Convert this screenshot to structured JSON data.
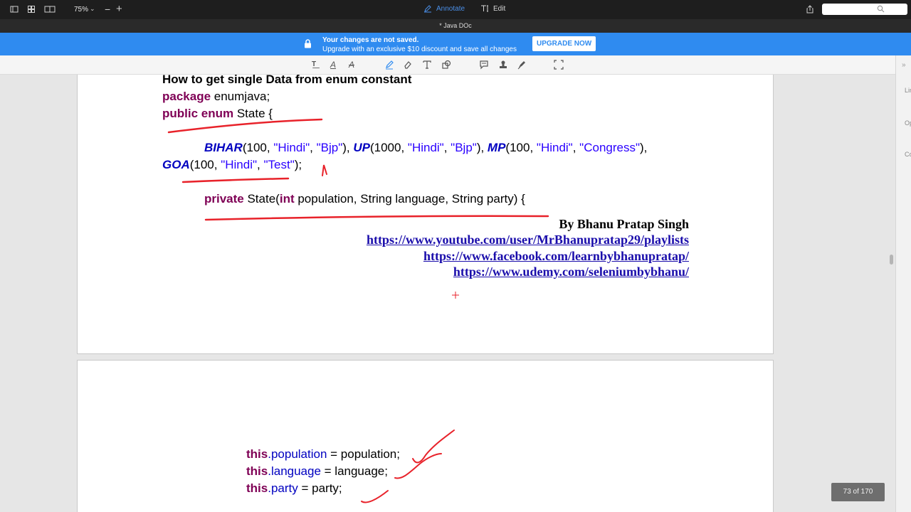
{
  "toolbar": {
    "zoom": "75%",
    "annotate_label": "Annotate",
    "edit_label": "Edit"
  },
  "document": {
    "title": "* Java DOc"
  },
  "banner": {
    "title": "Your changes are not saved.",
    "subtitle": "Upgrade with an exclusive $10 discount and save all changes",
    "button": "UPGRADE NOW",
    "color": "#2f8bf0"
  },
  "right_panel": {
    "labels": [
      "Lin",
      "Op",
      "Co"
    ]
  },
  "page1": {
    "heading": "How to get single Data from enum constant",
    "line_package_kw": "package",
    "line_package_rest": " enumjava;",
    "line_enum_kw": "public enum",
    "line_enum_rest": " State {",
    "bihar": "BIHAR",
    "bihar_args_a": "(100, ",
    "hindi1": "\"Hindi\"",
    "sep1": ", ",
    "bjp1": "\"Bjp\"",
    "close1": "), ",
    "up": "UP",
    "up_args_a": "(1000, ",
    "hindi2": "\"Hindi\"",
    "sep2": ", ",
    "bjp2": "\"Bjp\"",
    "close2": "), ",
    "mp": "MP",
    "mp_args_a": "(100, ",
    "hindi3": "\"Hindi\"",
    "sep3": ", ",
    "congress": "\"Congress\"",
    "close3": "),",
    "goa": "GOA",
    "goa_args_a": "(100, ",
    "hindi4": "\"Hindi\"",
    "sep4": ", ",
    "test": "\"Test\"",
    "close4": ");",
    "ctor_kw": "private",
    "ctor_a": " State(",
    "ctor_int": "int",
    "ctor_b": " population, String language, String party) {",
    "author": "By Bhanu Pratap Singh",
    "links": [
      "https://www.youtube.com/user/MrBhanupratap29/playlists",
      "https://www.facebook.com/learnbybhanupratap/",
      "https://www.udemy.com/seleniumbybhanu/"
    ]
  },
  "page2": {
    "this1_kw": "this",
    "this1_field": ".population",
    "this1_rest": " = population;",
    "this2_kw": "this",
    "this2_field": ".language",
    "this2_rest": " = language;",
    "this3_kw": "this",
    "this3_field": ".party",
    "this3_rest": " = party;"
  },
  "page_counter": "73 of 170",
  "ink_color": "#e8222a"
}
